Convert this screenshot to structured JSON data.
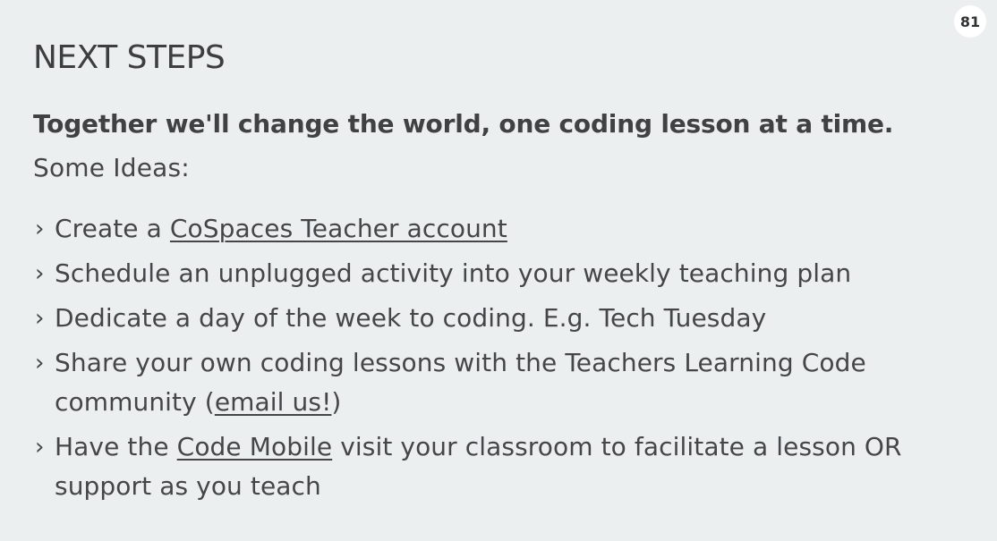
{
  "page_number": "81",
  "title": "NEXT STEPS",
  "lead": "Together we'll change the world, one coding lesson at a time.",
  "subhead": "Some Ideas:",
  "bullet_glyph": "›",
  "ideas": [
    {
      "before": "Create a ",
      "link": "CoSpaces Teacher account",
      "after": ""
    },
    {
      "text": "Schedule an unplugged activity into your weekly teaching plan"
    },
    {
      "text": "Dedicate a day of the week to coding. E.g. Tech Tuesday"
    },
    {
      "before": "Share your own coding lessons with the Teachers Learning Code community (",
      "link": "email us!",
      "after": ")"
    },
    {
      "before": "Have the ",
      "link": "Code Mobile",
      "after": " visit your classroom to facilitate a lesson OR support as you teach"
    }
  ]
}
